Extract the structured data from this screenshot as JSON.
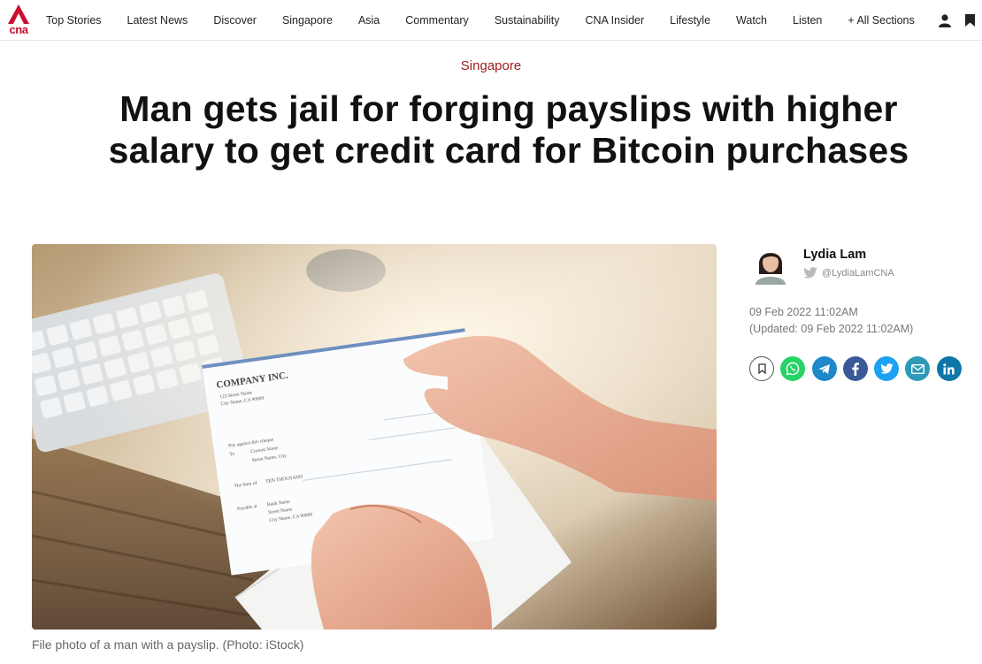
{
  "nav": {
    "logo_text": "cna",
    "items": [
      "Top Stories",
      "Latest News",
      "Discover",
      "Singapore",
      "Asia",
      "Commentary",
      "Sustainability",
      "CNA Insider",
      "Lifestyle",
      "Watch",
      "Listen",
      "+ All Sections"
    ],
    "icons": [
      "user-icon",
      "bookmark-icon"
    ]
  },
  "article": {
    "section": "Singapore",
    "headline_line1": "Man gets jail for forging payslips with higher",
    "headline_line2": "salary to get credit card for Bitcoin purchases",
    "image": {
      "payslip_company": "COMPANY INC.",
      "payslip_address1": "123 Street Name",
      "payslip_address2": "City Name, CA 90000",
      "payslip_pay": "Pay against this cheque",
      "payslip_to": "To",
      "payslip_current": "Current Name",
      "payslip_street": "Street Name, City",
      "payslip_sum_label": "The Sum of",
      "payslip_sum": "TEN THOUSAND",
      "payslip_payable": "Payable at",
      "payslip_bank1": "Bank Name",
      "payslip_bank2": "Street Name",
      "payslip_bank3": "City Name, CA 90000"
    },
    "caption": "File photo of a man with a payslip. (Photo: iStock)"
  },
  "author": {
    "name": "Lydia Lam",
    "twitter": "@LydiaLamCNA",
    "date": "09 Feb 2022 11:02AM",
    "updated": "(Updated: 09 Feb 2022 11:02AM)"
  },
  "share": [
    {
      "name": "bookmark",
      "icon": "bookmark-icon",
      "color": "#ffffff"
    },
    {
      "name": "whatsapp",
      "icon": "whatsapp-icon",
      "color": "#25d366"
    },
    {
      "name": "telegram",
      "icon": "telegram-icon",
      "color": "#1e88c9"
    },
    {
      "name": "facebook",
      "icon": "facebook-icon",
      "color": "#3b5998"
    },
    {
      "name": "twitter",
      "icon": "twitter-icon",
      "color": "#1da1f2"
    },
    {
      "name": "email",
      "icon": "email-icon",
      "color": "#2e9ab8"
    },
    {
      "name": "linkedin",
      "icon": "linkedin-icon",
      "color": "#0e76a8"
    }
  ],
  "colors": {
    "brand_red": "#c8102e",
    "section_red": "#9e1b1f"
  }
}
